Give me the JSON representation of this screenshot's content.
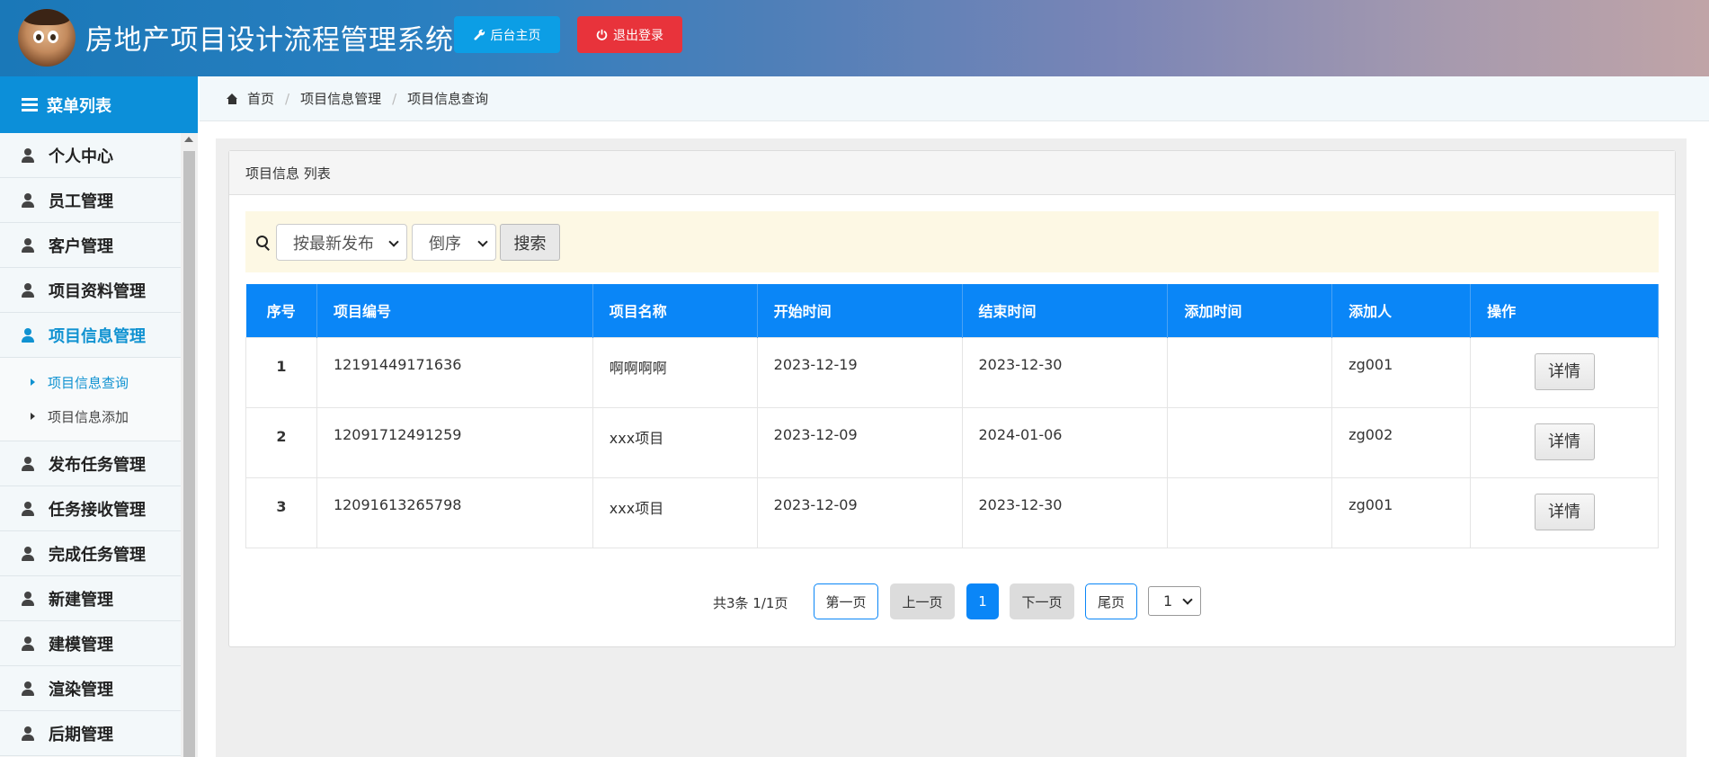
{
  "header": {
    "title": "房地产项目设计流程管理系统",
    "home_button": "后台主页",
    "logout_button": "退出登录"
  },
  "sidebar": {
    "title": "菜单列表",
    "items": [
      {
        "label": "个人中心"
      },
      {
        "label": "员工管理"
      },
      {
        "label": "客户管理"
      },
      {
        "label": "项目资料管理"
      },
      {
        "label": "项目信息管理",
        "active": true,
        "children": [
          {
            "label": "项目信息查询",
            "active": true
          },
          {
            "label": "项目信息添加"
          }
        ]
      },
      {
        "label": "发布任务管理"
      },
      {
        "label": "任务接收管理"
      },
      {
        "label": "完成任务管理"
      },
      {
        "label": "新建管理"
      },
      {
        "label": "建模管理"
      },
      {
        "label": "渲染管理"
      },
      {
        "label": "后期管理"
      }
    ]
  },
  "breadcrumb": [
    "首页",
    "项目信息管理",
    "项目信息查询"
  ],
  "panel": {
    "title": "项目信息 列表",
    "search": {
      "sort_value": "按最新发布",
      "order_value": "倒序",
      "button": "搜索"
    },
    "table": {
      "columns": [
        "序号",
        "项目编号",
        "项目名称",
        "开始时间",
        "结束时间",
        "添加时间",
        "添加人",
        "操作"
      ],
      "rows": [
        {
          "no": "1",
          "code": "12191449171636",
          "name": "啊啊啊啊",
          "start": "2023-12-19",
          "end": "2023-12-30",
          "added": "",
          "by": "zg001",
          "action": "详情"
        },
        {
          "no": "2",
          "code": "12091712491259",
          "name": "xxx项目",
          "start": "2023-12-09",
          "end": "2024-01-06",
          "added": "",
          "by": "zg002",
          "action": "详情"
        },
        {
          "no": "3",
          "code": "12091613265798",
          "name": "xxx项目",
          "start": "2023-12-09",
          "end": "2023-12-30",
          "added": "",
          "by": "zg001",
          "action": "详情"
        }
      ]
    },
    "pager": {
      "info": "共3条 1/1页",
      "first": "第一页",
      "prev": "上一页",
      "current": "1",
      "next": "下一页",
      "last": "尾页",
      "page_select": "1"
    }
  },
  "colors": {
    "primary": "#0a86f7",
    "sidebar_head": "#0c8fd9",
    "home_button": "#0c9ee5",
    "logout_button": "#e8333b",
    "search_bar_bg": "#fdf8e4"
  }
}
